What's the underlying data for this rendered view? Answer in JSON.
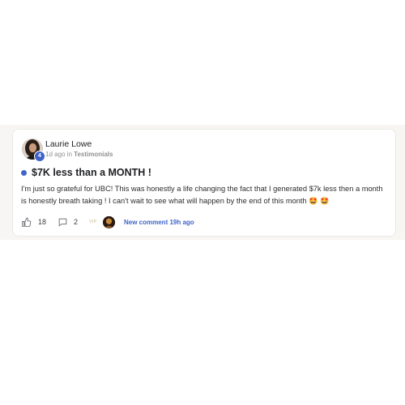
{
  "post": {
    "author": {
      "name": "Laurie Lowe",
      "level": "4",
      "avatar_icon": "user-avatar"
    },
    "meta": {
      "time": "1d ago",
      "in_word": "in",
      "category": "Testimonials"
    },
    "title": "$7K less than a MONTH !",
    "body": "I'm just so grateful for UBC! This was honestly a life changing the fact that I generated $7k less then a month is honestly breath taking ! I can't wait to see what will happen by the end of this month",
    "body_emojis": "🤩 🤩",
    "likes": "18",
    "comments": "2",
    "vip_label": "VIP",
    "new_comment": "New comment 19h ago"
  },
  "colors": {
    "accent": "#3f63c8",
    "background_band": "#f7f6f3",
    "card": "#ffffff",
    "text": "#202124",
    "muted": "#909090"
  },
  "icons": {
    "like": "thumbs-up-icon",
    "comment": "comment-bubble-icon"
  }
}
